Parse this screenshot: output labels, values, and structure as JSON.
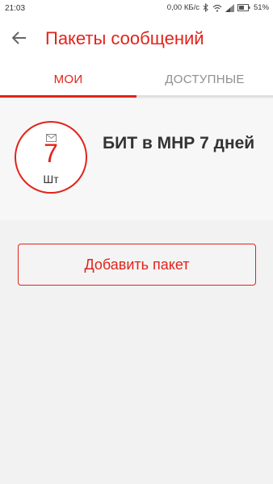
{
  "status_bar": {
    "time": "21:03",
    "network_speed": "0,00 КБ/с",
    "battery_percent": "51%",
    "icons": [
      "bluetooth-icon",
      "wifi-icon",
      "signal-icon",
      "battery-icon"
    ]
  },
  "header": {
    "title": "Пакеты сообщений",
    "back_icon": "arrow-left-icon"
  },
  "tabs": [
    {
      "label": "МОИ",
      "active": true
    },
    {
      "label": "ДОСТУПНЫЕ",
      "active": false
    }
  ],
  "package": {
    "count": "7",
    "unit": "Шт",
    "icon": "envelope-icon",
    "name": "БИТ в МНР 7 дней"
  },
  "actions": {
    "add_label": "Добавить пакет"
  },
  "colors": {
    "accent": "#e2231a",
    "background": "#f2f2f2",
    "card_background": "#f7f7f7",
    "tab_inactive": "#8f8f8f"
  }
}
